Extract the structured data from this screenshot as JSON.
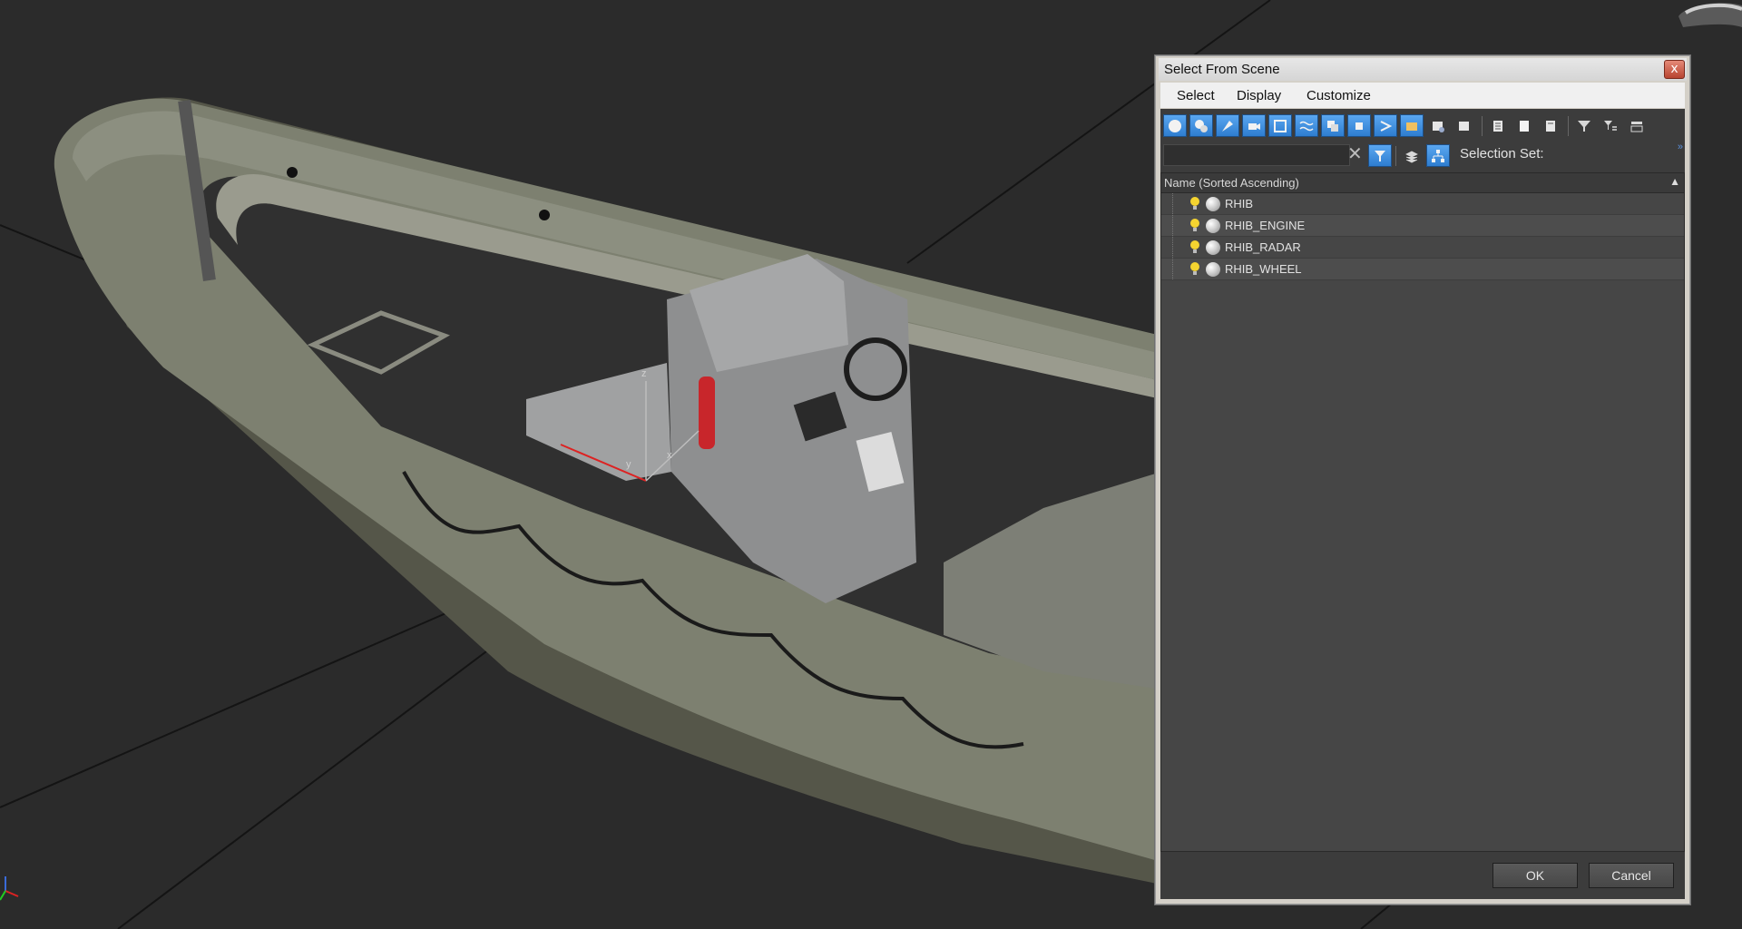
{
  "dialog": {
    "title": "Select From Scene",
    "close_label": "x",
    "menu": [
      "Select",
      "Display",
      "Customize"
    ],
    "filter": {
      "search_value": "",
      "selection_set_label": "Selection Set:"
    },
    "list": {
      "column_header": "Name (Sorted Ascending)",
      "items": [
        {
          "name": "RHIB"
        },
        {
          "name": "RHIB_ENGINE"
        },
        {
          "name": "RHIB_RADAR"
        },
        {
          "name": "RHIB_WHEEL"
        }
      ]
    },
    "buttons": {
      "ok": "OK",
      "cancel": "Cancel"
    }
  },
  "viewport": {
    "gizmo_labels": {
      "x": "x",
      "y": "y",
      "z": "z"
    }
  },
  "colors": {
    "viewport_bg": "#2b2b2b",
    "accent_blue": "#2e7dd0",
    "hull_color": "#7d8070",
    "deck_color": "#2f2f2f",
    "console_color": "#8e8f90",
    "extinguisher_red": "#c8262b"
  },
  "icons": [
    "select-all-icon",
    "select-geometry-icon",
    "select-lights-icon",
    "select-cameras-icon",
    "select-helpers-icon",
    "select-spacewarps-icon",
    "select-groups-icon",
    "select-xrefs-icon",
    "select-bones-icon",
    "select-containers-icon",
    "select-frozen-icon",
    "select-hidden-icon",
    "list-view-icon",
    "blank-page-icon",
    "page-icon",
    "filter-icon",
    "filter-options-icon",
    "columns-icon"
  ]
}
